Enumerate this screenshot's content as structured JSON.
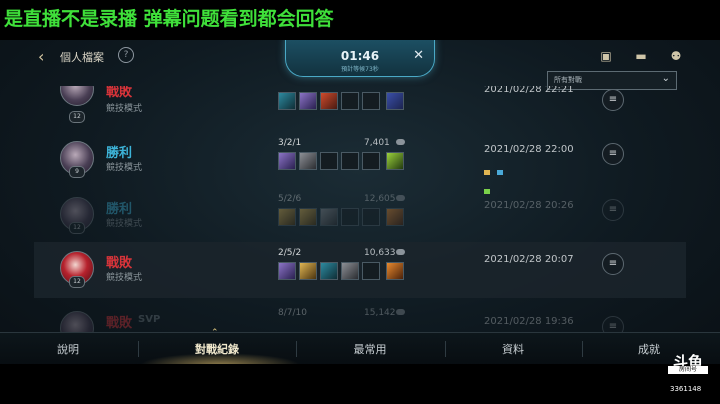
{
  "stream_banner": "是直播不是录播 弹幕问题看到都会回答",
  "header": {
    "back_icon": "‹",
    "title": "個人檔案",
    "help": "?"
  },
  "timer": {
    "time": "01:46",
    "subtitle": "預計等候73秒",
    "close": "✕"
  },
  "filter": {
    "label": "所有對戰",
    "chevron": "⌄"
  },
  "matches": [
    {
      "result": "戰敗",
      "mode": "競技模式",
      "level": "12",
      "kda": "",
      "gold": "",
      "date": "2021/02/28 22:21",
      "outcome": "loss"
    },
    {
      "result": "勝利",
      "mode": "競技模式",
      "level": "9",
      "kda": "3/2/1",
      "gold": "7,401",
      "date": "2021/02/28 22:00",
      "outcome": "win"
    },
    {
      "result": "勝利",
      "mode": "競技模式",
      "level": "12",
      "kda": "5/2/6",
      "gold": "12,605",
      "date": "2021/02/28 20:26",
      "outcome": "win"
    },
    {
      "result": "戰敗",
      "mode": "競技模式",
      "level": "12",
      "kda": "2/5/2",
      "gold": "10,633",
      "date": "2021/02/28 20:07",
      "outcome": "loss"
    },
    {
      "result": "戰敗",
      "mode": "SVP",
      "level": "",
      "kda": "8/7/10",
      "gold": "15,142",
      "date": "2021/02/28 19:36",
      "outcome": "loss"
    }
  ],
  "nav": {
    "items": [
      "說明",
      "對戰紀錄",
      "最常用",
      "資料",
      "成就"
    ],
    "active": "對戰紀錄"
  },
  "watermark": {
    "logo": "斗鱼",
    "logo_sub": "房间号",
    "room": "3361148"
  },
  "colors": {
    "win": "#3db3d8",
    "loss": "#d8343a",
    "banner_text": "#3fe03a"
  }
}
